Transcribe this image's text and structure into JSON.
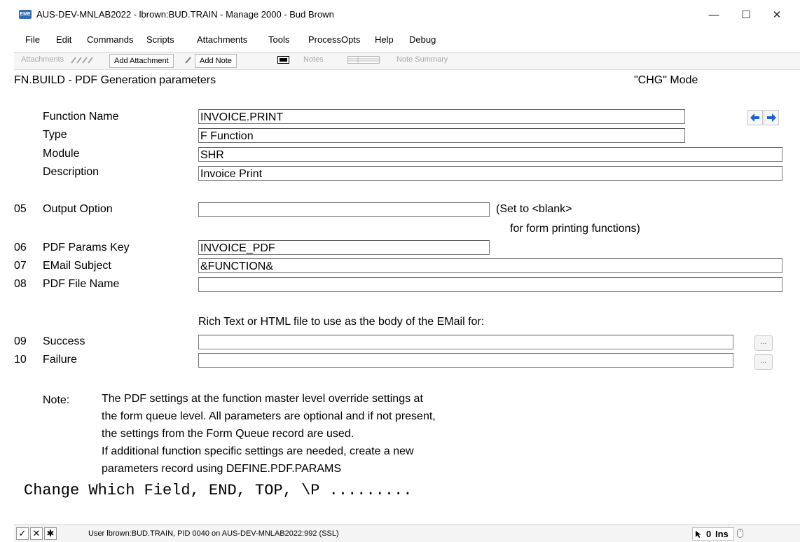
{
  "window": {
    "app_icon": "EME",
    "title": "AUS-DEV-MNLAB2022 - lbrown:BUD.TRAIN - Manage 2000 - Bud Brown",
    "minimize": "—",
    "maximize": "☐",
    "close": "✕"
  },
  "menu": [
    "File",
    "Edit",
    "Commands",
    "Scripts",
    "Attachments",
    "Tools",
    "ProcessOpts",
    "Help",
    "Debug"
  ],
  "toolbar": {
    "attachments": "Attachments",
    "add_attachment": "Add Attachment",
    "add_note": "Add Note",
    "notes": "Notes",
    "note_summary": "Note Summary"
  },
  "screen": {
    "title": "FN.BUILD - PDF Generation parameters",
    "mode": "\"CHG\" Mode",
    "function_name_label": "Function Name",
    "function_name_value": "INVOICE.PRINT",
    "type_label": "Type",
    "type_value": "F Function",
    "module_label": "Module",
    "module_value": "SHR",
    "description_label": "Description",
    "description_value": "Invoice Print",
    "f05_num": "05",
    "f05_label": "Output Option",
    "f05_value": "",
    "f05_hint1": "(Set to <blank>",
    "f05_hint2": "for form printing functions)",
    "f06_num": "06",
    "f06_label": "PDF Params Key",
    "f06_value": "INVOICE_PDF",
    "f07_num": "07",
    "f07_label": "EMail Subject",
    "f07_value": "&FUNCTION&",
    "f08_num": "08",
    "f08_label": "PDF File Name",
    "f08_value": "",
    "rich_text_label": "Rich Text or HTML file to use as the body of the EMail for:",
    "f09_num": "09",
    "f09_label": "Success",
    "f09_value": "",
    "f10_num": "10",
    "f10_label": "Failure",
    "f10_value": "",
    "ellipsis": "...",
    "note_label": "Note:",
    "note_lines": [
      "The PDF settings at the function master level override settings at",
      "the form queue level. All parameters are optional and if not present,",
      "the settings from the Form Queue record are used.",
      "If additional function specific settings are needed, create a new",
      "parameters record using DEFINE.PDF.PARAMS"
    ],
    "prompt": "Change Which Field, END, TOP, \\P ........."
  },
  "statusbar": {
    "check": "✓",
    "x": "✕",
    "star": "✱",
    "text": "User lbrown:BUD.TRAIN, PID 0040 on AUS-DEV-MNLAB2022:992 (SSL)",
    "count": "0",
    "ins": "Ins"
  },
  "colors": {
    "nav_arrow": "#1a5fd6",
    "app_icon": "#2f6db5"
  },
  "icons": [
    "app-icon",
    "paperclip-icon",
    "note-icon",
    "notes-icon",
    "arrow-left-icon",
    "arrow-right-icon",
    "cursor-icon",
    "mouse-icon"
  ]
}
